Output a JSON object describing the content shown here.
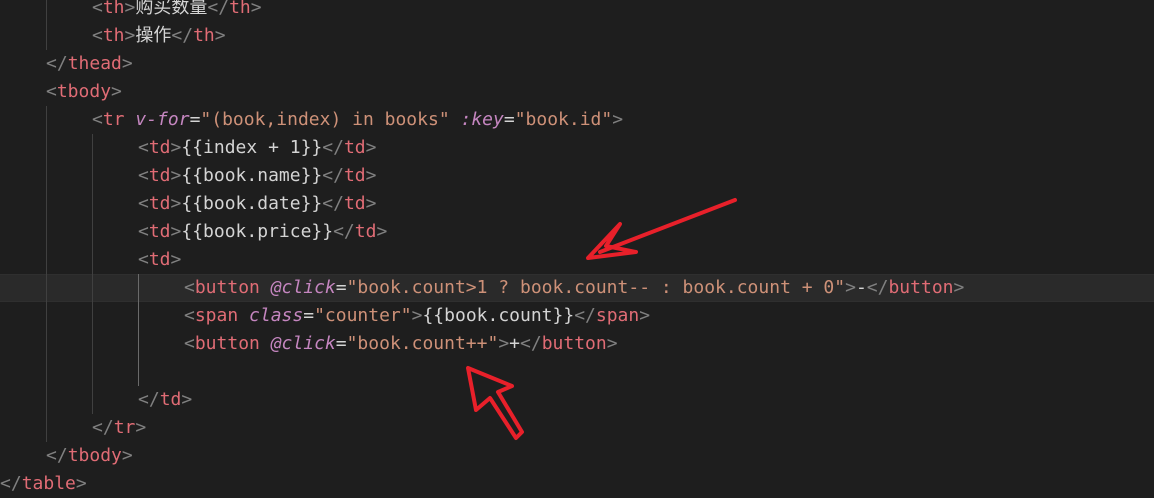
{
  "editor": {
    "lines": [
      {
        "tokens": [
          [
            "p",
            "<"
          ],
          [
            "tagc",
            "th"
          ],
          [
            "p",
            ">"
          ],
          [
            "x",
            "购买数量"
          ],
          [
            "p",
            "</"
          ],
          [
            "tagc",
            "th"
          ],
          [
            "p",
            ">"
          ]
        ]
      },
      {
        "tokens": [
          [
            "p",
            "<"
          ],
          [
            "tagc",
            "th"
          ],
          [
            "p",
            ">"
          ],
          [
            "x",
            "操作"
          ],
          [
            "p",
            "</"
          ],
          [
            "tagc",
            "th"
          ],
          [
            "p",
            ">"
          ]
        ]
      },
      {
        "tokens": [
          [
            "p",
            "</"
          ],
          [
            "tagc",
            "thead"
          ],
          [
            "p",
            ">"
          ]
        ]
      },
      {
        "tokens": [
          [
            "p",
            "<"
          ],
          [
            "tagc",
            "tbody"
          ],
          [
            "p",
            ">"
          ]
        ]
      },
      {
        "tokens": [
          [
            "p",
            "<"
          ],
          [
            "tagc",
            "tr"
          ],
          [
            "x",
            " "
          ],
          [
            "d",
            "v-for"
          ],
          [
            "x",
            "="
          ],
          [
            "s",
            "\"(book,index) in books\""
          ],
          [
            "x",
            " "
          ],
          [
            "d",
            ":key"
          ],
          [
            "x",
            "="
          ],
          [
            "s",
            "\"book.id\""
          ],
          [
            "p",
            ">"
          ]
        ]
      },
      {
        "tokens": [
          [
            "p",
            "<"
          ],
          [
            "tagc",
            "td"
          ],
          [
            "p",
            ">"
          ],
          [
            "x",
            "{{index + 1}}"
          ],
          [
            "p",
            "</"
          ],
          [
            "tagc",
            "td"
          ],
          [
            "p",
            ">"
          ]
        ]
      },
      {
        "tokens": [
          [
            "p",
            "<"
          ],
          [
            "tagc",
            "td"
          ],
          [
            "p",
            ">"
          ],
          [
            "x",
            "{{book.name}}"
          ],
          [
            "p",
            "</"
          ],
          [
            "tagc",
            "td"
          ],
          [
            "p",
            ">"
          ]
        ]
      },
      {
        "tokens": [
          [
            "p",
            "<"
          ],
          [
            "tagc",
            "td"
          ],
          [
            "p",
            ">"
          ],
          [
            "x",
            "{{book.date}}"
          ],
          [
            "p",
            "</"
          ],
          [
            "tagc",
            "td"
          ],
          [
            "p",
            ">"
          ]
        ]
      },
      {
        "tokens": [
          [
            "p",
            "<"
          ],
          [
            "tagc",
            "td"
          ],
          [
            "p",
            ">"
          ],
          [
            "x",
            "{{book.price}}"
          ],
          [
            "p",
            "</"
          ],
          [
            "tagc",
            "td"
          ],
          [
            "p",
            ">"
          ]
        ]
      },
      {
        "tokens": [
          [
            "p",
            "<"
          ],
          [
            "tagc",
            "td"
          ],
          [
            "p",
            ">"
          ]
        ]
      },
      {
        "tokens": [
          [
            "p",
            "<"
          ],
          [
            "tagc",
            "button"
          ],
          [
            "x",
            " "
          ],
          [
            "d",
            "@click"
          ],
          [
            "x",
            "="
          ],
          [
            "s",
            "\"book.count>1 ? book.count-- : book.count + 0\""
          ],
          [
            "p",
            ">"
          ],
          [
            "x",
            "-"
          ],
          [
            "p",
            "</"
          ],
          [
            "tagc",
            "button"
          ],
          [
            "p",
            ">"
          ]
        ]
      },
      {
        "tokens": [
          [
            "p",
            "<"
          ],
          [
            "tagc",
            "span"
          ],
          [
            "x",
            " "
          ],
          [
            "d",
            "class"
          ],
          [
            "x",
            "="
          ],
          [
            "s",
            "\"counter\""
          ],
          [
            "p",
            ">"
          ],
          [
            "x",
            "{{book.count}}"
          ],
          [
            "p",
            "</"
          ],
          [
            "tagc",
            "span"
          ],
          [
            "p",
            ">"
          ]
        ]
      },
      {
        "tokens": [
          [
            "p",
            "<"
          ],
          [
            "tagc",
            "button"
          ],
          [
            "x",
            " "
          ],
          [
            "d",
            "@click"
          ],
          [
            "x",
            "="
          ],
          [
            "s",
            "\"book.count++\""
          ],
          [
            "p",
            ">"
          ],
          [
            "x",
            "+"
          ],
          [
            "p",
            "</"
          ],
          [
            "tagc",
            "button"
          ],
          [
            "p",
            ">"
          ]
        ]
      },
      {
        "tokens": []
      },
      {
        "tokens": [
          [
            "p",
            "</"
          ],
          [
            "tagc",
            "td"
          ],
          [
            "p",
            ">"
          ]
        ]
      },
      {
        "tokens": [
          [
            "p",
            "</"
          ],
          [
            "tagc",
            "tr"
          ],
          [
            "p",
            ">"
          ]
        ]
      },
      {
        "tokens": [
          [
            "p",
            "</"
          ],
          [
            "tagc",
            "tbody"
          ],
          [
            "p",
            ">"
          ]
        ]
      },
      {
        "tokens": [
          [
            "p",
            "</"
          ],
          [
            "tagc",
            "table"
          ],
          [
            "p",
            ">"
          ]
        ]
      }
    ],
    "annotation": {
      "arrow_color": "#e8202a"
    }
  }
}
